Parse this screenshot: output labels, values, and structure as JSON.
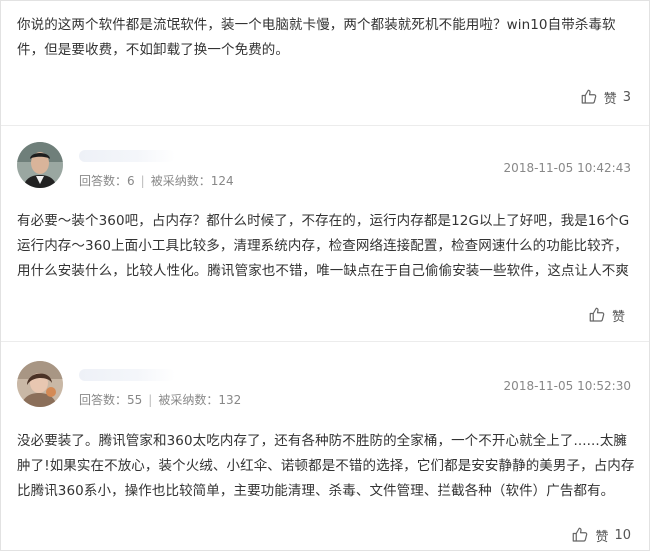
{
  "answers": [
    {
      "text": "你说的这两个软件都是流氓软件，装一个电脑就卡慢，两个都装就死机不能用啦？win10自带杀毒软件，但是要收费，不如卸载了换一个免费的。",
      "like_label": "赞",
      "like_count": "3"
    },
    {
      "stats": {
        "answers_label": "回答数：",
        "answers": "6",
        "sep": "|",
        "adopted_label": "被采纳数：",
        "adopted": "124"
      },
      "time": "2018-11-05 10:42:43",
      "text": "有必要～装个360吧，占内存？都什么时候了，不存在的，运行内存都是12G以上了好吧，我是16个G运行内存～360上面小工具比较多，清理系统内存，检查网络连接配置，检查网速什么的功能比较齐，用什么安装什么，比较人性化。腾讯管家也不错，唯一缺点在于自己偷偷安装一些软件，这点让人不爽",
      "like_label": "赞",
      "like_count": ""
    },
    {
      "stats": {
        "answers_label": "回答数：",
        "answers": "55",
        "sep": "|",
        "adopted_label": "被采纳数：",
        "adopted": "132"
      },
      "time": "2018-11-05 10:52:30",
      "text": "没必要装了。腾讯管家和360太吃内存了，还有各种防不胜防的全家桶，一个不开心就全上了......太臃肿了!如果实在不放心，装个火绒、小红伞、诺顿都是不错的选择，它们都是安安静静的美男子，占内存比腾讯360系小，操作也比较简单，主要功能清理、杀毒、文件管理、拦截各种（软件）广告都有。",
      "like_label": "赞",
      "like_count": "10"
    }
  ],
  "icons": {
    "like": "thumbs-up-icon",
    "avatar1": "avatar-man",
    "avatar2": "avatar-woman"
  },
  "colors": {
    "text": "#333333",
    "meta": "#888888",
    "divider": "#ececec"
  }
}
